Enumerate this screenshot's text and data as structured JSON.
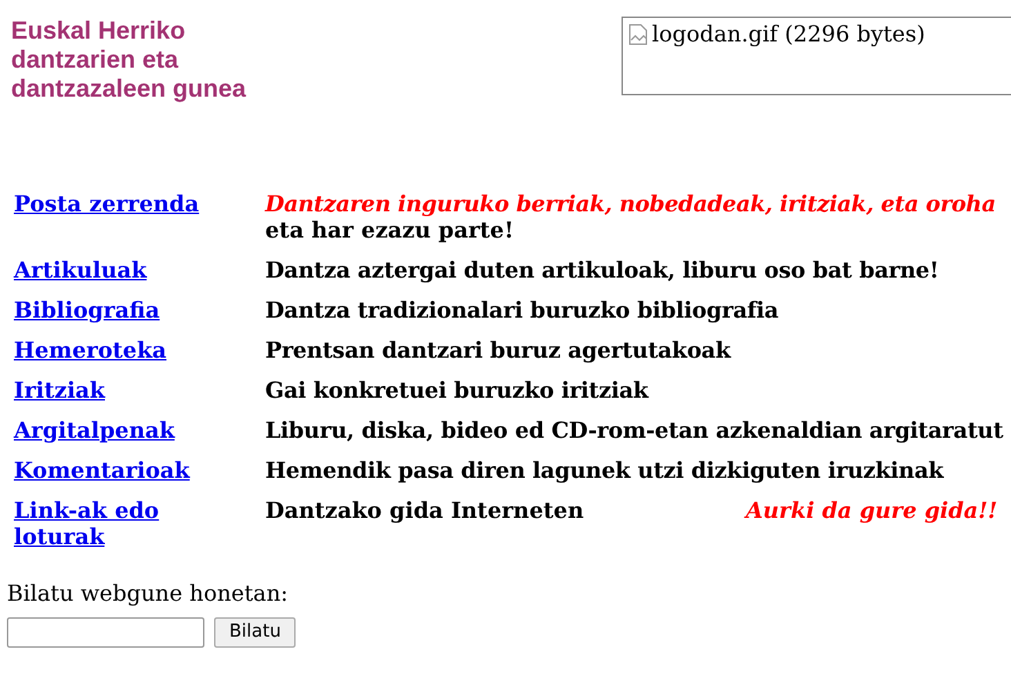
{
  "site_title": [
    "Euskal Herriko",
    "dantzarien eta",
    "dantzazaleen gunea"
  ],
  "logo": {
    "alt_text": "logodan.gif (2296 bytes)"
  },
  "sections": [
    {
      "kind": "two_line",
      "link": "Posta zerrenda",
      "highlight": "Dantzaren inguruko berriak, nobedadeak, iritziak, eta oroha",
      "description": "eta har ezazu parte!"
    },
    {
      "kind": "plain",
      "link": "Artikuluak",
      "description": "Dantza aztergai duten artikuloak, liburu oso bat barne!"
    },
    {
      "kind": "plain",
      "link": "Bibliografia",
      "description": "Dantza tradizionalari buruzko bibliografia"
    },
    {
      "kind": "plain",
      "link": "Hemeroteka",
      "description": "Prentsan dantzari buruz agertutakoak"
    },
    {
      "kind": "plain",
      "link": "Iritziak",
      "description": "Gai konkretuei buruzko iritziak"
    },
    {
      "kind": "plain",
      "link": "Argitalpenak",
      "description": "Liburu, diska, bideo ed CD-rom-etan azkenaldian argitaratut"
    },
    {
      "kind": "plain",
      "link": "Komentarioak",
      "description": "Hemendik pasa diren lagunek utzi dizkiguten iruzkinak"
    },
    {
      "kind": "with_note",
      "link": "Link-ak edo loturak",
      "description": "Dantzako gida Interneten",
      "note": "Aurki da gure gida!!"
    }
  ],
  "search": {
    "label": "Bilatu webgune honetan:",
    "button": "Bilatu"
  }
}
